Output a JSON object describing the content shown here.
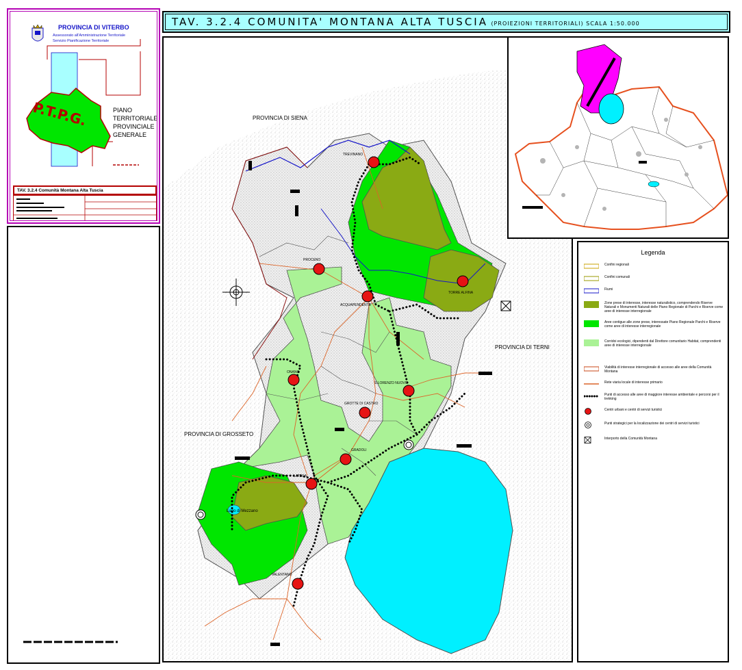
{
  "title_block": {
    "provincia": "PROVINCIA DI VITERBO",
    "assessorato": "Assessorato all'Amministrazione Territoriale",
    "servizio": "Servizio Pianificazione Territoriale",
    "ptpg_letters": "P.T.P.G.",
    "plan_lines": [
      "PIANO",
      "TERRITORIALE",
      "PROVINCIALE",
      "GENERALE"
    ],
    "caption": "TAV. 3.2.4 Comunità Montana Alta Tuscia"
  },
  "title_bar": {
    "main": "TAV. 3.2.4 COMUNITA' MONTANA ALTA TUSCIA",
    "sub": "(PROIEZIONI TERRITORIALI) SCALA 1:50.000"
  },
  "map_labels": {
    "provincia_siena": "PROVINCIA DI SIENA",
    "provincia_terni": "PROVINCIA DI TERNI",
    "provincia_grosseto": "PROVINCIA DI GROSSETO",
    "trevinano": "TREVINANO",
    "proceno": "PROCENO",
    "acquapendente": "ACQUAPENDENTE",
    "torre_alfina": "TORRE ALFINA",
    "onano": "ONANO",
    "s_lorenzo_nuovo": "S.LORENZO NUOVO",
    "grotte_di_castro": "GROTTE DI CASTRO",
    "gradoli": "GRADOLI",
    "latera": "LATERA",
    "valentano": "VALENTANO",
    "lago_mezzano": "Lago di Mezzano"
  },
  "legend": {
    "title": "Legenda",
    "items": [
      {
        "label": "Confini regionali",
        "kind": "line",
        "color": "#c8a000"
      },
      {
        "label": "Confini comunali",
        "kind": "line",
        "color": "#9a9a00"
      },
      {
        "label": "Fiumi",
        "kind": "line",
        "color": "#1414c8"
      },
      {
        "label": "Zone prese di interesse, interesse naturalistico, comprendendo Riserve Naturali e Monumenti Naturali delle Piano Regionale di Parchi e Riserve come aree di interesse interregionale",
        "kind": "fill",
        "color": "#8aaa14"
      },
      {
        "label": "Aree contigue alle zone prese, interessate Piano Regionale Parchi e Riserve come aree di interesse interregionale",
        "kind": "fill",
        "color": "#00e600"
      },
      {
        "label": "Corridoi ecologici, dipendenti dal Direttore comunitario Habitat, comprendenti aree di interesse interregionale",
        "kind": "fill",
        "color": "#aaf296"
      },
      {
        "label": "Viabilità di interesse interregionale di accesso alle aree della Comunità Montana",
        "kind": "double-line",
        "color": "#c84614"
      },
      {
        "label": "Rete viaria locale di interesse primario",
        "kind": "line",
        "color": "#dc6428"
      },
      {
        "label": "Punti di accesso alle aree di maggiore interesse ambientale e percorsi per il trekking",
        "kind": "dots",
        "color": "#000000"
      },
      {
        "label": "Centri urbani e centri di servizi turistici",
        "kind": "circle-red",
        "color": "#e61414"
      },
      {
        "label": "Punti strategici per la localizzazione dei centri di servizi turistici",
        "kind": "circle-ring",
        "color": "#000000"
      },
      {
        "label": "Interporto della Comunità Montana",
        "kind": "boxx",
        "color": "#000000"
      }
    ]
  }
}
